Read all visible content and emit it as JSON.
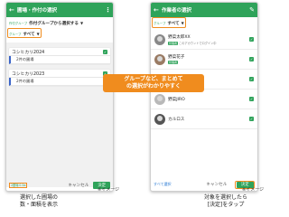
{
  "left_phone": {
    "title": "圃場・作付の選択",
    "picker_label": "作付グループ",
    "picker_value": "作付グループから選択する",
    "group_label": "グループ",
    "group_value": "すべて",
    "cards": [
      {
        "name": "コシヒカリ2024",
        "sub": "2件の圃場"
      },
      {
        "name": "コシヒカリ2023",
        "sub": "2件の圃場"
      }
    ],
    "count_line1": "2圃場 0.5a",
    "count_line2": "0.5a",
    "cancel": "キャンセル",
    "decide": "決定"
  },
  "right_phone": {
    "title": "作業者の選択",
    "group_label": "グループ",
    "group_value": "すべて",
    "people": [
      {
        "name": "野菜太郎XX",
        "badge": "管理者",
        "note": "このアカウントでログイン中"
      },
      {
        "name": "野菜花子",
        "badge": "管理者",
        "note": ""
      },
      {
        "name": "野菜一郎",
        "badge": "",
        "note": "メッセージ"
      },
      {
        "name": "野菜JIRO",
        "badge": "",
        "note": ""
      },
      {
        "name": "カルロス",
        "badge": "",
        "note": ""
      }
    ],
    "select_all": "すべて選択",
    "cancel": "キャンセル",
    "decide": "決定"
  },
  "callouts": {
    "group": "グループなど、まとめて\nの選択がわかりやすく"
  },
  "notes": {
    "left": "※イメージ",
    "right": "※イメージ"
  },
  "captions": {
    "left": "選択した圃場の\n数・面積を表示",
    "right": "対象を選択したら\n[決定]をタップ"
  }
}
